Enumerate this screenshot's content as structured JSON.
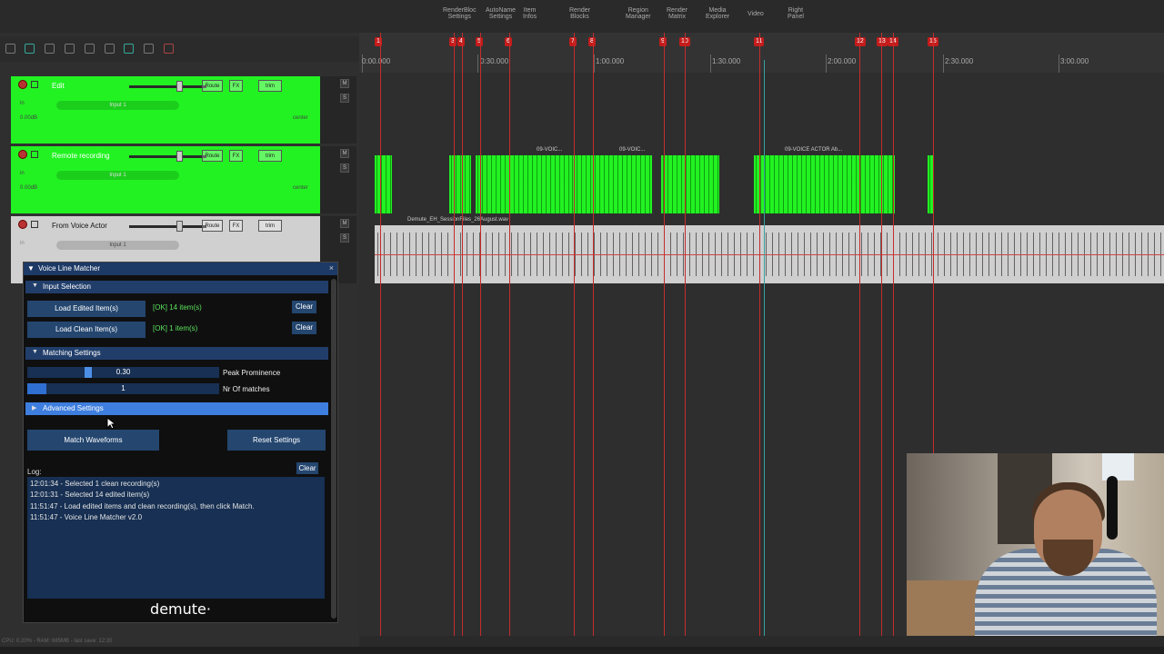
{
  "toolbar": {
    "items": [
      "RenderBloc\nSettings",
      "AutoName\nSettings",
      "Item\nInfos",
      "Render\nBlocks",
      "Region\nManager",
      "Render\nMatrix",
      "Media\nExplorer",
      "Video",
      "Right\nPanel"
    ]
  },
  "ruler": {
    "markers": [
      "1",
      "3",
      "4",
      "5",
      "6",
      "7",
      "8",
      "9",
      "10",
      "11",
      "12",
      "13",
      "14",
      "15"
    ],
    "times": [
      "0:00.000",
      "0:30.000",
      "1:00.000",
      "1:30.000",
      "2:00.000",
      "2:30.000",
      "3:00.000"
    ]
  },
  "tracks": [
    {
      "name": "Edit",
      "input": "Input 1",
      "vol": "0.00dB",
      "pan": "center",
      "route": "Route",
      "fx": "FX",
      "trim": "trim",
      "in": "in",
      "color": "#22f222"
    },
    {
      "name": "Remote recording",
      "input": "Input 1",
      "vol": "0.00dB",
      "pan": "center",
      "route": "Route",
      "fx": "FX",
      "trim": "trim",
      "in": "in",
      "color": "#22f222"
    },
    {
      "name": "From Voice Actor",
      "input": "Input 1",
      "vol": "0.00dB",
      "pan": "center",
      "route": "Route",
      "fx": "FX",
      "trim": "trim",
      "in": "in",
      "color": "#d0d0d0"
    }
  ],
  "meter_buttons": [
    "M",
    "S"
  ],
  "clips": {
    "green_labels": [
      "09-VOIC...",
      "09-VOIC...",
      "09-VOICE ACTOR Ab..."
    ],
    "grey_label": "Demute_EH_SessionFiles_26August.wav"
  },
  "plugin": {
    "title": "Voice Line Matcher",
    "close": "×",
    "input_section": "Input Selection",
    "load_edited": "Load Edited Item(s)",
    "load_edited_status": "[OK] 14 item(s)",
    "load_clean": "Load Clean Item(s)",
    "load_clean_status": "[OK] 1 item(s)",
    "clear": "Clear",
    "matching_section": "Matching Settings",
    "peak_value": "0.30",
    "peak_fraction": 0.3,
    "peak_label": "Peak Prominence",
    "matches_value": "1",
    "matches_fraction": 0.1,
    "matches_label": "Nr Of matches",
    "advanced_section": "Advanced Settings",
    "match_button": "Match Waveforms",
    "reset_button": "Reset Settings",
    "log_label": "Log:",
    "log_clear": "Clear",
    "log_lines": [
      "12:01:34 - Selected 1 clean recording(s)",
      "12:01:31 - Selected 14 edited item(s)",
      "11:51:47 - Load edited items and clean recording(s), then click Match.",
      "11:51:47 - Voice Line Matcher v2.0"
    ],
    "brand": "demute·"
  },
  "statusbar": "CPU: 0.20% - RAM: 685MB - last save: 12:20"
}
